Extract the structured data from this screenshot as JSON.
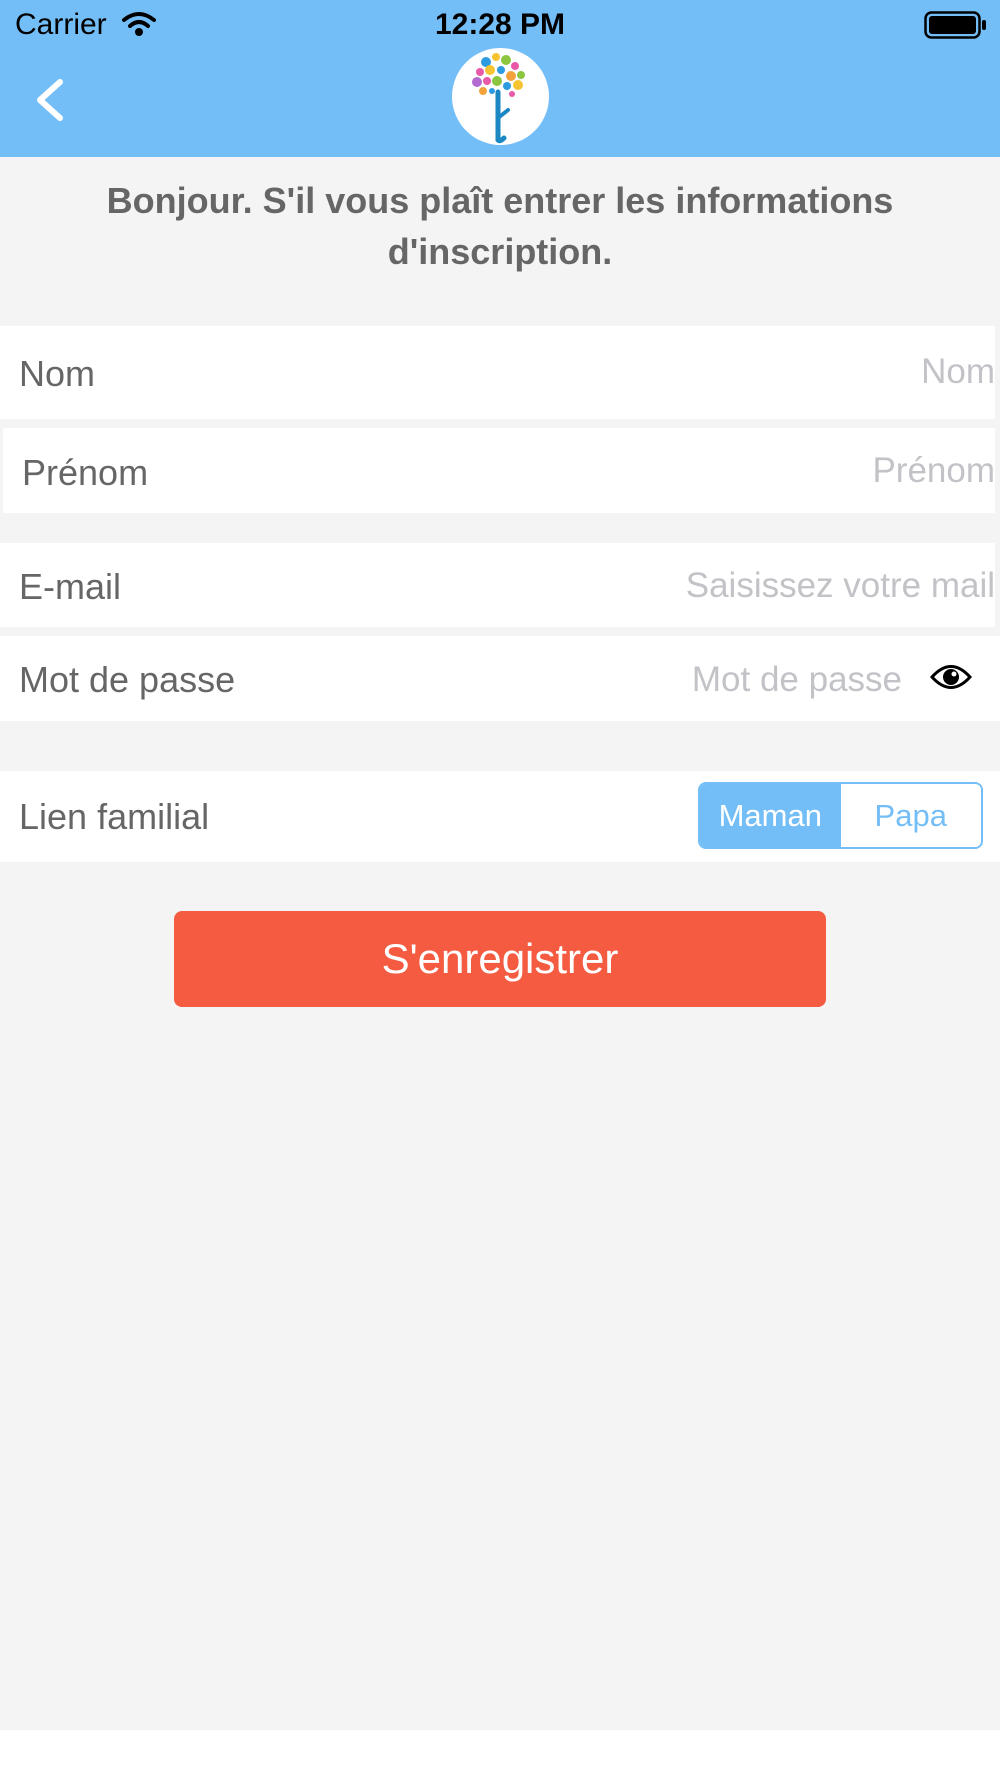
{
  "status_bar": {
    "carrier": "Carrier",
    "time": "12:28 PM"
  },
  "header": {
    "back_icon": "chevron-left-icon",
    "logo_icon": "tree-logo-icon"
  },
  "intro": "Bonjour. S'il vous plaît entrer les informations d'inscription.",
  "form": {
    "nom": {
      "label": "Nom",
      "placeholder": "Nom"
    },
    "prenom": {
      "label": "Prénom",
      "placeholder": "Prénom"
    },
    "email": {
      "label": "E-mail",
      "placeholder": "Saisissez votre mail"
    },
    "password": {
      "label": "Mot de passe",
      "placeholder": "Mot de passe",
      "toggle_icon": "eye-icon"
    },
    "relation": {
      "label": "Lien familial",
      "options": [
        "Maman",
        "Papa"
      ],
      "selected": "Maman"
    }
  },
  "register_button": "S'enregistrer",
  "colors": {
    "header": "#74bef7",
    "accent": "#74bef7",
    "button": "#f45b41",
    "background": "#f4f4f4"
  }
}
